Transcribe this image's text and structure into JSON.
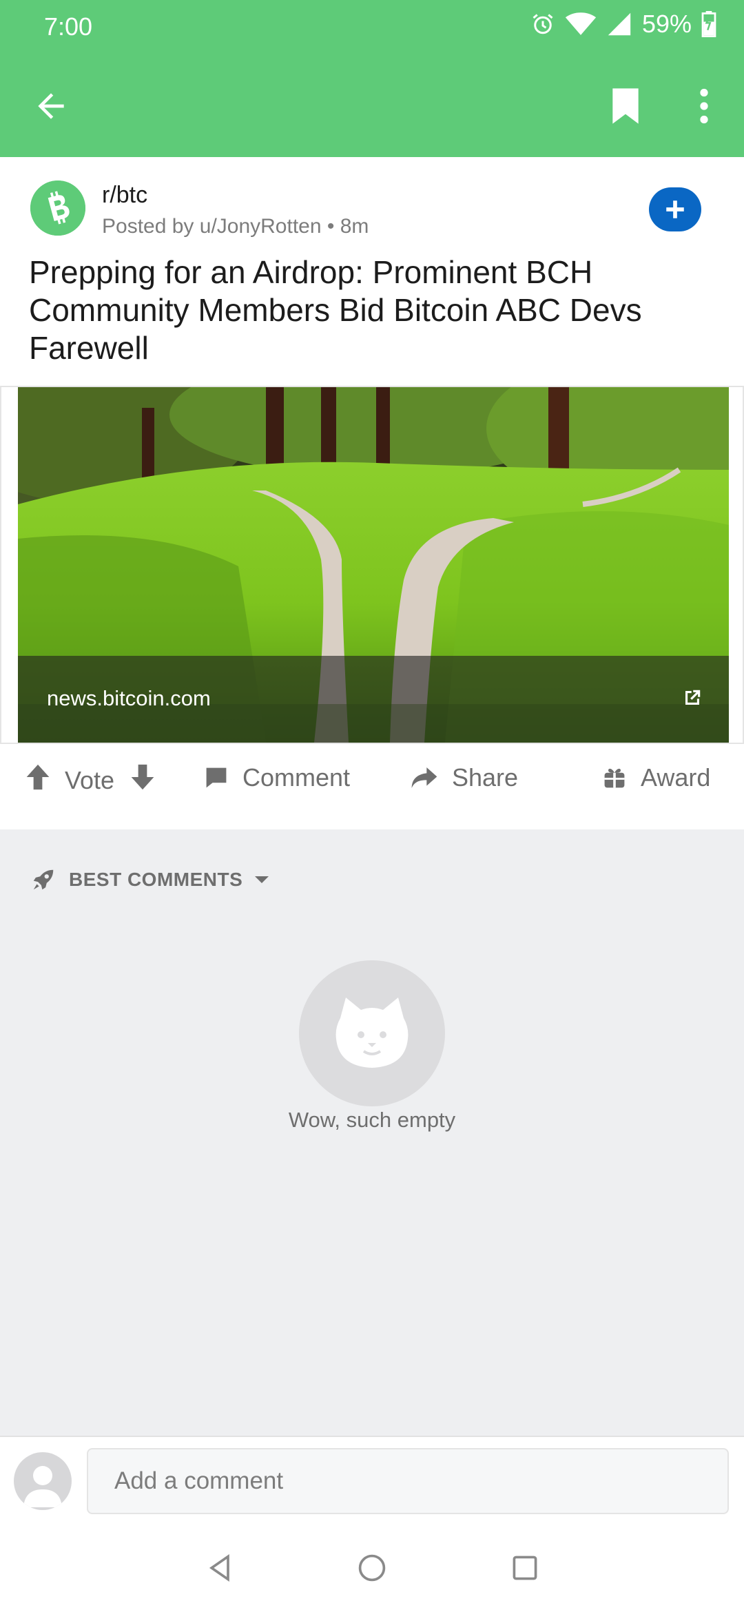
{
  "status_bar": {
    "time": "7:00",
    "battery": "59%"
  },
  "subreddit": {
    "name": "r/btc",
    "posted_by": "Posted by u/JonyRotten",
    "age": "8m"
  },
  "post": {
    "title": "Prepping for an Airdrop: Prominent BCH Community Members Bid Bitcoin ABC Devs Farewell",
    "link_domain": "news.bitcoin.com"
  },
  "actions": {
    "vote": "Vote",
    "comment": "Comment",
    "share": "Share",
    "award": "Award"
  },
  "comments": {
    "sort_label": "BEST COMMENTS",
    "empty_text": "Wow, such empty"
  },
  "composer": {
    "placeholder": "Add a comment"
  },
  "colors": {
    "header": "#5ecb78",
    "join_button": "#0a67c4"
  }
}
